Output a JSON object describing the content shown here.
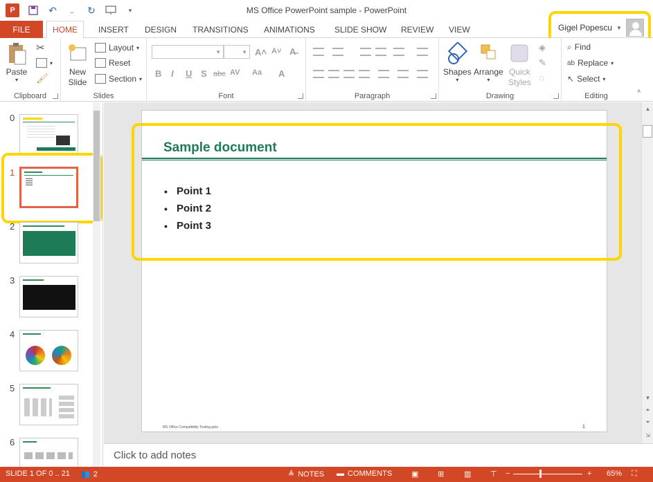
{
  "window": {
    "title": "MS Office PowerPoint sample - PowerPoint"
  },
  "tabs": {
    "file": "FILE",
    "items": [
      "HOME",
      "INSERT",
      "DESIGN",
      "TRANSITIONS",
      "ANIMATIONS",
      "SLIDE SHOW",
      "REVIEW",
      "VIEW"
    ],
    "active": "HOME"
  },
  "user": {
    "name": "Gigel Popescu"
  },
  "ribbon": {
    "clipboard": {
      "label": "Clipboard",
      "paste": "Paste"
    },
    "slides": {
      "label": "Slides",
      "new_slide": "New\nSlide",
      "layout": "Layout",
      "reset": "Reset",
      "section": "Section"
    },
    "font": {
      "label": "Font"
    },
    "paragraph": {
      "label": "Paragraph"
    },
    "drawing": {
      "label": "Drawing",
      "shapes": "Shapes",
      "arrange": "Arrange",
      "quick_styles": "Quick\nStyles"
    },
    "editing": {
      "label": "Editing",
      "find": "Find",
      "replace": "Replace",
      "select": "Select"
    }
  },
  "thumbnails": [
    {
      "num": "0"
    },
    {
      "num": "1"
    },
    {
      "num": "2"
    },
    {
      "num": "3"
    },
    {
      "num": "4"
    },
    {
      "num": "5"
    },
    {
      "num": "6"
    }
  ],
  "slide": {
    "title": "Sample document",
    "bullets": [
      "Point 1",
      "Point 2",
      "Point 3"
    ],
    "footer": "MS Office Compatibility Testing.pptx",
    "page_number": "1"
  },
  "notes": {
    "placeholder": "Click to add notes"
  },
  "status": {
    "slide_info": "SLIDE 1 OF 0 .. 21",
    "authors": "2",
    "notes": "NOTES",
    "comments": "COMMENTS",
    "zoom": "65%"
  },
  "colors": {
    "accent": "#d24726",
    "slide_title": "#1e7b57",
    "highlight": "#ffd500"
  }
}
